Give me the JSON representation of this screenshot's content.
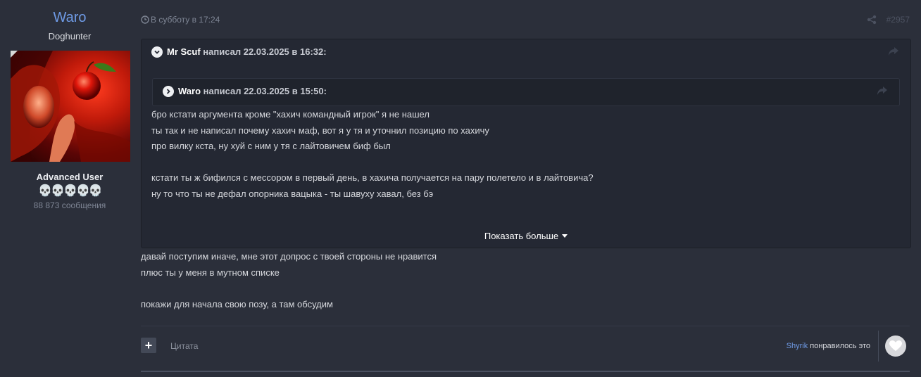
{
  "author": {
    "username": "Waro",
    "custom_title": "Doghunter",
    "group": "Advanced User",
    "rank_icons": "💀💀💀💀💀",
    "posts_count": "88 873 сообщения"
  },
  "post": {
    "timestamp": "В субботу в 17:24",
    "number": "#2957",
    "outer_quote": {
      "author": "Mr Scuf",
      "wrote_text": "написал 22.03.2025 в 16:32:",
      "inner_quote": {
        "author": "Waro",
        "wrote_text": "написал 22.03.2025 в 15:50:"
      },
      "lines": [
        "бро кстати аргумента кроме \"хахич командный игрок\" я не нашел",
        "ты так и не написал почему хахич маф, вот я у тя и уточнил позицию по хахичу",
        "про вилку кста, ну хуй с ним у тя с лайтовичем биф был",
        "",
        "кстати ты ж бифился с мессором в первый день, в хахича получается на пару полетело и в лайтовича?",
        "ну то что ты не дефал опорника вацыка - ты шавуху хавал, без бэ"
      ],
      "show_more_label": "Показать больше"
    },
    "body_lines": [
      "давай поступим иначе, мне этот допрос с твоей стороны не нравится",
      "плюс ты у меня в мутном списке",
      "",
      "покажи для начала свою позу, а там обсудим"
    ],
    "footer": {
      "multiquote_label": "+",
      "quote_label": "Цитата",
      "liked_by": "Shyrik",
      "liked_text": "понравилось это"
    }
  }
}
